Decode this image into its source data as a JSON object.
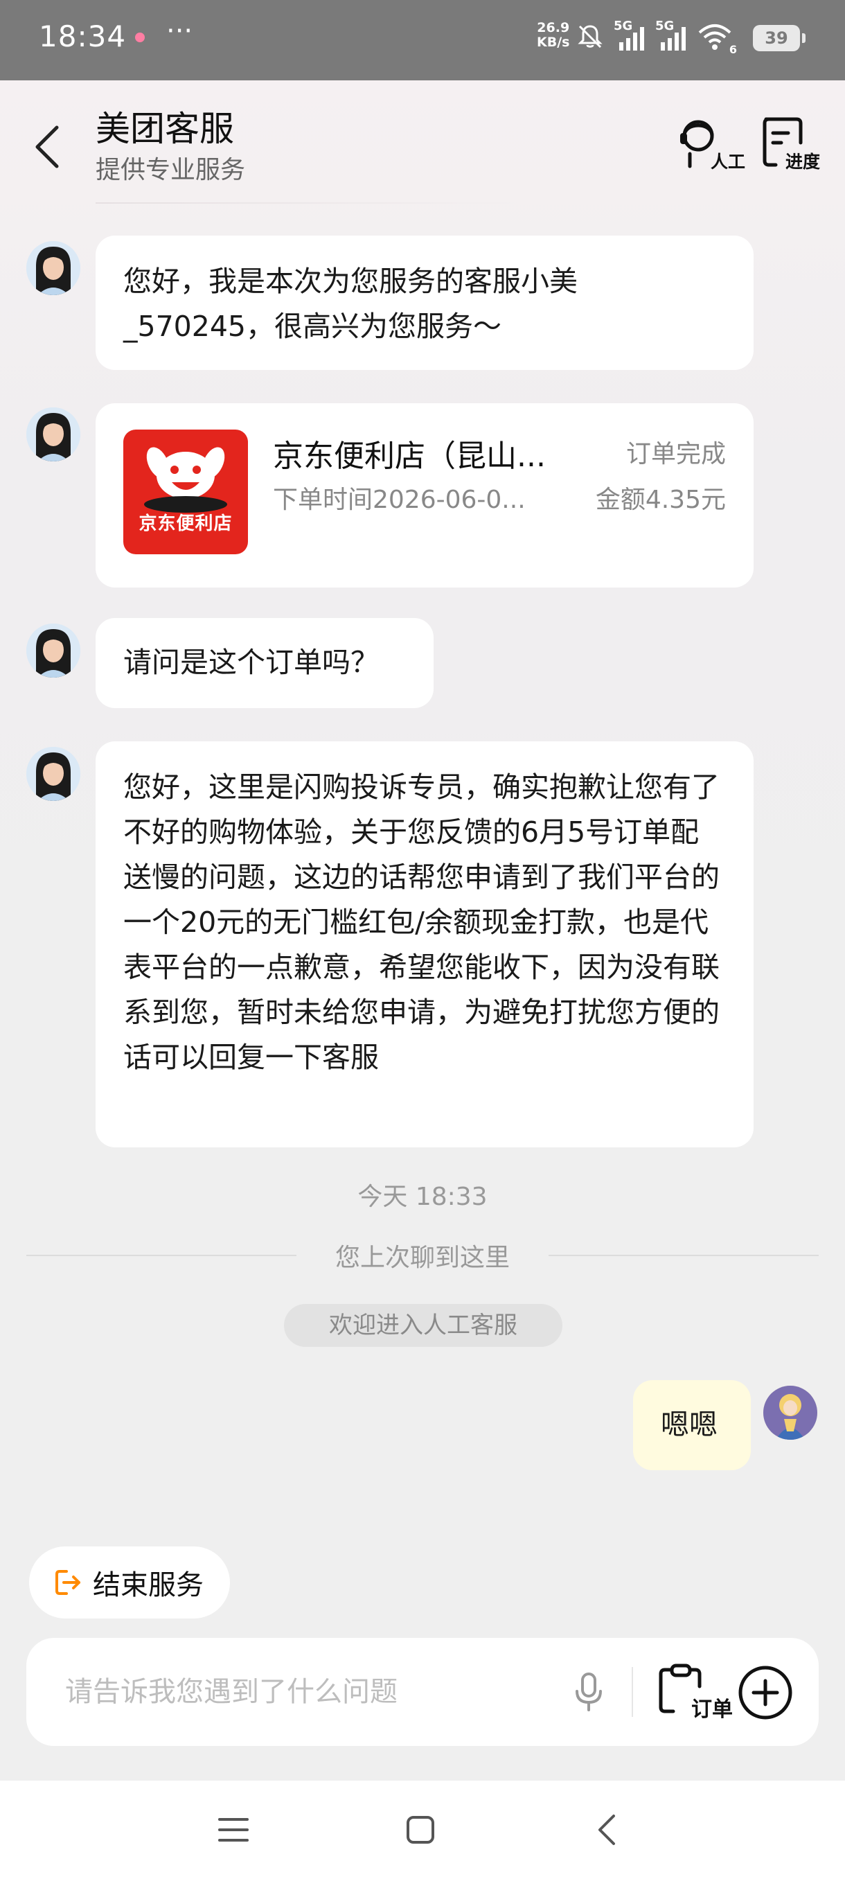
{
  "status_bar": {
    "time": "18:34",
    "more": "···",
    "net_speed_value": "26.9",
    "net_speed_unit": "KB/s",
    "signal_1": "5G",
    "signal_2": "5G",
    "wifi_label": "6",
    "battery": "39"
  },
  "header": {
    "title": "美团客服",
    "subtitle": "提供专业服务",
    "human_agent_label": "人工",
    "progress_label": "进度"
  },
  "messages": {
    "m1": "您好，我是本次为您服务的客服小美_570245，很高兴为您服务～",
    "order_card": {
      "shop_name": "京东便利店（昆山...",
      "logo_text": "京东便利店",
      "status": "订单完成",
      "order_time": "下单时间2026-06-0...",
      "amount": "金额4.35元"
    },
    "m3": "请问是这个订单吗？",
    "m4": "您好，这里是闪购投诉专员，确实抱歉让您有了不好的购物体验，关于您反馈的6月5号订单配送慢的问题，这边的话帮您申请到了我们平台的一个20元的无门槛红包/余额现金打款，也是代表平台的一点歉意，希望您能收下，因为没有联系到您，暂时未给您申请，为避免打扰您方便的话可以回复一下客服",
    "timestamp": "今天 18:33",
    "last_read": "您上次聊到这里",
    "welcome": "欢迎进入人工客服",
    "user_reply": "嗯嗯"
  },
  "bottom": {
    "end_service_label": "结束服务",
    "input_placeholder": "请告诉我您遇到了什么问题",
    "input_value": "",
    "order_button_label": "订单"
  },
  "colors": {
    "status_bar_bg": "#7a7a7a",
    "user_bubble": "#fffbdf",
    "end_icon": "#ff8a00",
    "shop_logo_bg": "#e3251d"
  },
  "icons": {
    "back": "chevron-left-icon",
    "human_agent": "headset-person-icon",
    "progress": "document-icon",
    "mic": "microphone-icon",
    "order": "clipboard-icon",
    "plus": "plus-circle-icon",
    "end_service": "exit-icon"
  }
}
